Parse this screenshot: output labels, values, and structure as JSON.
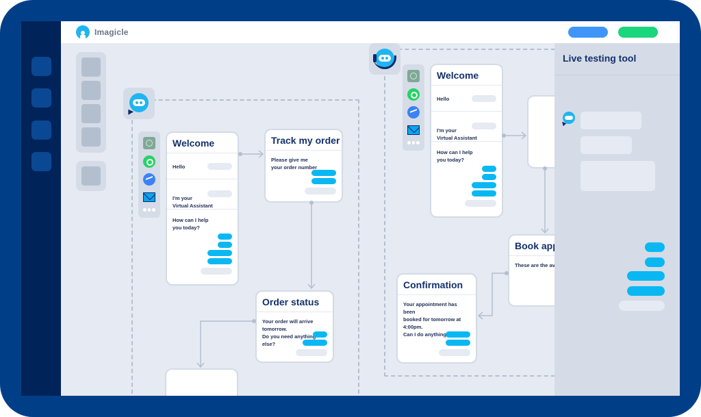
{
  "app": {
    "brand": "Imagicle",
    "topbar_buttons": [
      {
        "name": "primary-action",
        "color": "#3f96f8"
      },
      {
        "name": "secondary-action",
        "color": "#1ad67c"
      }
    ]
  },
  "colors": {
    "device_frame": "#003f87",
    "nav_rail": "#00235a",
    "canvas_bg": "#e6eaf2",
    "accent_bubble": "#09b8f2",
    "title_text": "#13306b"
  },
  "nav_rail": {
    "items": [
      "nav-item-1",
      "nav-item-2",
      "nav-item-3",
      "nav-item-4"
    ]
  },
  "palette": {
    "tools": [
      "tool-1",
      "tool-2",
      "tool-3",
      "tool-4"
    ],
    "extra_tool": "tool-5"
  },
  "channels": [
    "chatgpt-icon",
    "whatsapp-icon",
    "messenger-icon",
    "email-icon",
    "more-icon"
  ],
  "flow_left": {
    "bot_icon": "chatbot-icon",
    "welcome": {
      "title": "Welcome",
      "rows": [
        {
          "text": "Hello"
        },
        {
          "text": "I'm your\nVirtual Assistant"
        }
      ],
      "question": "How can I help\nyou today?"
    },
    "track_order": {
      "title": "Track my order",
      "text": "Please give me\nyour order number"
    },
    "order_status": {
      "title": "Order status",
      "text": "Your order will arrive tomorrow.\nDo you need anything else?"
    }
  },
  "flow_right": {
    "bot_icon": "voicebot-headset-icon",
    "welcome": {
      "title": "Welcome",
      "rows": [
        {
          "text": "Hello"
        },
        {
          "text": "I'm your\nVirtual Assistant"
        }
      ],
      "question": "How can I help\nyou today?"
    },
    "book_appointment": {
      "title": "Book app",
      "text": "These are the avail"
    },
    "confirmation": {
      "title": "Confirmation",
      "text": "Your appointment has been\nbooked for tomorrow at 4:00pm.\nCan I do anything else?"
    }
  },
  "live_testing": {
    "title": "Live testing tool"
  }
}
